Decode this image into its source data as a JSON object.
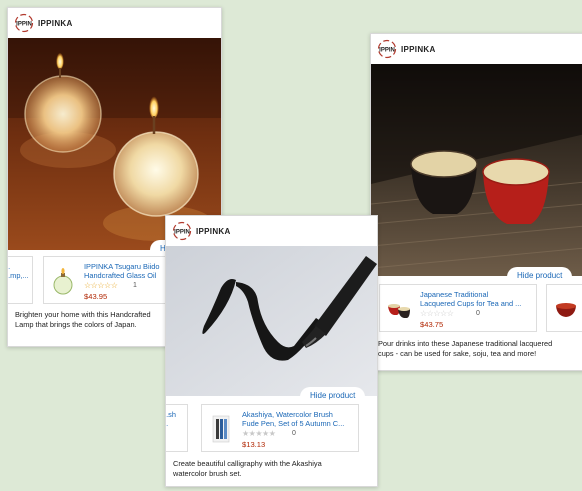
{
  "brand": "IPPINKA",
  "logo_text": "IPPIN",
  "hide_label": "Hide product",
  "cards": {
    "lamp": {
      "hide_label": "Hide",
      "product_title": "IPPINKA Tsugaru Biido\nHandcrafted Glass Oil",
      "peek_title": "...\n...mp,...",
      "stars": "☆☆☆☆☆",
      "rating_count": "1",
      "price": "$43.95",
      "description": "Brighten your home with this Handcrafted\nLamp that brings the colors of Japan."
    },
    "cups": {
      "product_title": "Japanese Traditional\nLacquered Cups for Tea and ...",
      "stars": "☆☆☆☆☆",
      "rating_count": "0",
      "price": "$43.75",
      "description": "Pour drinks into these Japanese traditional lacquered\ncups - can be used for sake, soju, tea and more!"
    },
    "brush": {
      "product_title": "Akashiya, Watercolor Brush\nFude Pen, Set of 5 Autumn C...",
      "peek_title": "...sh\n...",
      "stars": "★★★★★",
      "rating_count": "0",
      "price": "$13.13",
      "description": "Create beautiful calligraphy with the Akashiya\nwatercolor brush set."
    }
  },
  "colors": {
    "background": "#dde9d6",
    "link": "#1a67b6",
    "price": "#b12704",
    "star": "#e7a31a"
  },
  "icons": [
    "ippinka-logo-icon",
    "glass-lamp-thumbnail",
    "lacquer-cups-thumbnail",
    "brush-set-thumbnail"
  ]
}
